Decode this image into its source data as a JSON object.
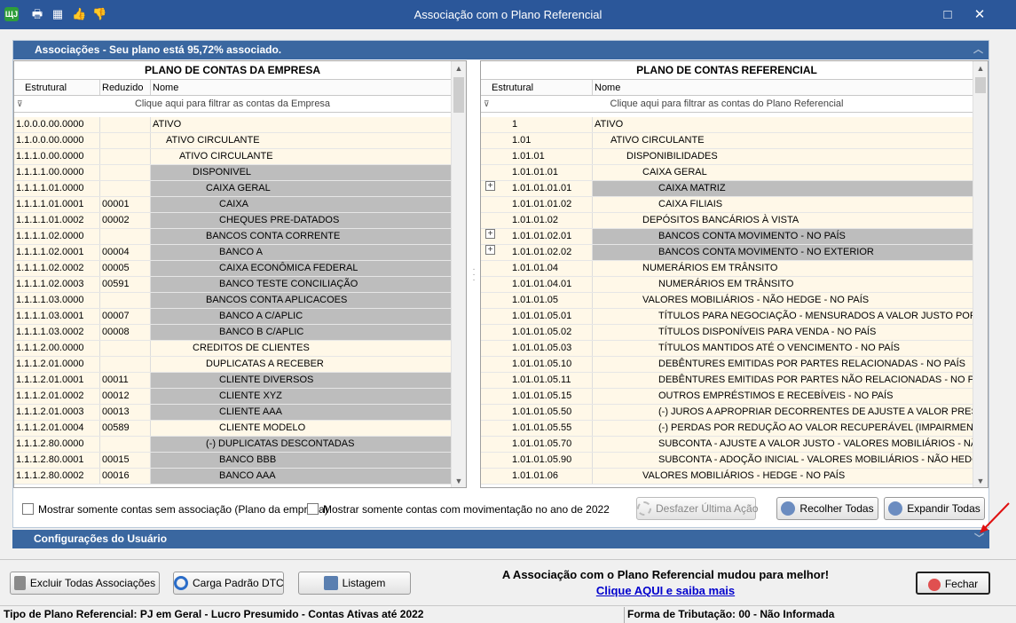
{
  "window": {
    "title": "Associação com o Plano Referencial",
    "maximize_glyph": "□",
    "close_glyph": "✕"
  },
  "assoc_header": "Associações - Seu plano está 95,72% associado.",
  "left_grid": {
    "title": "PLANO DE CONTAS DA EMPRESA",
    "col_estrutural": "Estrutural",
    "col_reduzido": "Reduzido",
    "col_nome": "Nome",
    "filter": "Clique aqui para filtrar as contas da Empresa",
    "rows": [
      {
        "e": "1.0.0.0.00.0000",
        "r": "",
        "n": "ATIVO",
        "lvl": 0,
        "sel": false
      },
      {
        "e": "1.1.0.0.00.0000",
        "r": "",
        "n": "ATIVO CIRCULANTE",
        "lvl": 1,
        "sel": false
      },
      {
        "e": "1.1.1.0.00.0000",
        "r": "",
        "n": "ATIVO CIRCULANTE",
        "lvl": 2,
        "sel": false
      },
      {
        "e": "1.1.1.1.00.0000",
        "r": "",
        "n": "DISPONIVEL",
        "lvl": 3,
        "sel": true
      },
      {
        "e": "1.1.1.1.01.0000",
        "r": "",
        "n": "CAIXA GERAL",
        "lvl": 4,
        "sel": true
      },
      {
        "e": "1.1.1.1.01.0001",
        "r": "00001",
        "n": "CAIXA",
        "lvl": 5,
        "sel": true
      },
      {
        "e": "1.1.1.1.01.0002",
        "r": "00002",
        "n": "CHEQUES PRE-DATADOS",
        "lvl": 5,
        "sel": true
      },
      {
        "e": "1.1.1.1.02.0000",
        "r": "",
        "n": "BANCOS CONTA CORRENTE",
        "lvl": 4,
        "sel": true
      },
      {
        "e": "1.1.1.1.02.0001",
        "r": "00004",
        "n": "BANCO A",
        "lvl": 5,
        "sel": true
      },
      {
        "e": "1.1.1.1.02.0002",
        "r": "00005",
        "n": "CAIXA ECONÔMICA FEDERAL",
        "lvl": 5,
        "sel": true
      },
      {
        "e": "1.1.1.1.02.0003",
        "r": "00591",
        "n": "BANCO TESTE CONCILIAÇÃO",
        "lvl": 5,
        "sel": true
      },
      {
        "e": "1.1.1.1.03.0000",
        "r": "",
        "n": "BANCOS CONTA APLICACOES",
        "lvl": 4,
        "sel": true
      },
      {
        "e": "1.1.1.1.03.0001",
        "r": "00007",
        "n": "BANCO A C/APLIC",
        "lvl": 5,
        "sel": true
      },
      {
        "e": "1.1.1.1.03.0002",
        "r": "00008",
        "n": "BANCO B C/APLIC",
        "lvl": 5,
        "sel": true
      },
      {
        "e": "1.1.1.2.00.0000",
        "r": "",
        "n": "CREDITOS DE CLIENTES",
        "lvl": 3,
        "sel": false
      },
      {
        "e": "1.1.1.2.01.0000",
        "r": "",
        "n": "DUPLICATAS A RECEBER",
        "lvl": 4,
        "sel": false
      },
      {
        "e": "1.1.1.2.01.0001",
        "r": "00011",
        "n": "CLIENTE DIVERSOS",
        "lvl": 5,
        "sel": true
      },
      {
        "e": "1.1.1.2.01.0002",
        "r": "00012",
        "n": "CLIENTE XYZ",
        "lvl": 5,
        "sel": true
      },
      {
        "e": "1.1.1.2.01.0003",
        "r": "00013",
        "n": "CLIENTE AAA",
        "lvl": 5,
        "sel": true
      },
      {
        "e": "1.1.1.2.01.0004",
        "r": "00589",
        "n": "CLIENTE MODELO",
        "lvl": 5,
        "sel": false
      },
      {
        "e": "1.1.1.2.80.0000",
        "r": "",
        "n": "(-) DUPLICATAS DESCONTADAS",
        "lvl": 4,
        "sel": true
      },
      {
        "e": "1.1.1.2.80.0001",
        "r": "00015",
        "n": "BANCO BBB",
        "lvl": 5,
        "sel": true
      },
      {
        "e": "1.1.1.2.80.0002",
        "r": "00016",
        "n": "BANCO AAA",
        "lvl": 5,
        "sel": true
      }
    ]
  },
  "right_grid": {
    "title": "PLANO DE CONTAS REFERENCIAL",
    "col_estrutural": "Estrutural",
    "col_nome": "Nome",
    "filter": "Clique aqui para filtrar as contas do Plano Referencial",
    "rows": [
      {
        "e": "1",
        "n": "ATIVO",
        "lvl": 0,
        "sel": false,
        "plus": false
      },
      {
        "e": "1.01",
        "n": "ATIVO CIRCULANTE",
        "lvl": 1,
        "sel": false,
        "plus": false
      },
      {
        "e": "1.01.01",
        "n": "DISPONIBILIDADES",
        "lvl": 2,
        "sel": false,
        "plus": false
      },
      {
        "e": "1.01.01.01",
        "n": "CAIXA GERAL",
        "lvl": 3,
        "sel": false,
        "plus": false
      },
      {
        "e": "1.01.01.01.01",
        "n": "CAIXA MATRIZ",
        "lvl": 4,
        "sel": true,
        "plus": true
      },
      {
        "e": "1.01.01.01.02",
        "n": "CAIXA FILIAIS",
        "lvl": 4,
        "sel": false,
        "plus": false
      },
      {
        "e": "1.01.01.02",
        "n": "DEPÓSITOS BANCÁRIOS À VISTA",
        "lvl": 3,
        "sel": false,
        "plus": false
      },
      {
        "e": "1.01.01.02.01",
        "n": "BANCOS CONTA MOVIMENTO - NO PAÍS",
        "lvl": 4,
        "sel": true,
        "plus": true
      },
      {
        "e": "1.01.01.02.02",
        "n": "BANCOS CONTA MOVIMENTO - NO EXTERIOR",
        "lvl": 4,
        "sel": true,
        "plus": true
      },
      {
        "e": "1.01.01.04",
        "n": "NUMERÁRIOS EM TRÂNSITO",
        "lvl": 3,
        "sel": false,
        "plus": false
      },
      {
        "e": "1.01.01.04.01",
        "n": "NUMERÁRIOS EM TRÂNSITO",
        "lvl": 4,
        "sel": false,
        "plus": false
      },
      {
        "e": "1.01.01.05",
        "n": "VALORES MOBILIÁRIOS - NÃO HEDGE - NO PAÍS",
        "lvl": 3,
        "sel": false,
        "plus": false
      },
      {
        "e": "1.01.01.05.01",
        "n": "TÍTULOS PARA NEGOCIAÇÃO - MENSURADOS A VALOR JUSTO POR MEIO",
        "lvl": 4,
        "sel": false,
        "plus": false
      },
      {
        "e": "1.01.01.05.02",
        "n": "TÍTULOS DISPONÍVEIS PARA VENDA - NO PAÍS",
        "lvl": 4,
        "sel": false,
        "plus": false
      },
      {
        "e": "1.01.01.05.03",
        "n": "TÍTULOS MANTIDOS ATÉ O VENCIMENTO - NO PAÍS",
        "lvl": 4,
        "sel": false,
        "plus": false
      },
      {
        "e": "1.01.01.05.10",
        "n": "DEBÊNTURES EMITIDAS POR PARTES RELACIONADAS - NO PAÍS",
        "lvl": 4,
        "sel": false,
        "plus": false
      },
      {
        "e": "1.01.01.05.11",
        "n": "DEBÊNTURES EMITIDAS POR PARTES NÃO RELACIONADAS - NO PAÍS",
        "lvl": 4,
        "sel": false,
        "plus": false
      },
      {
        "e": "1.01.01.05.15",
        "n": "OUTROS EMPRÉSTIMOS E RECEBÍVEIS - NO PAÍS",
        "lvl": 4,
        "sel": false,
        "plus": false
      },
      {
        "e": "1.01.01.05.50",
        "n": "(-) JUROS A APROPRIAR DECORRENTES DE AJUSTE A VALOR PRESENTE",
        "lvl": 4,
        "sel": false,
        "plus": false
      },
      {
        "e": "1.01.01.05.55",
        "n": "(-) PERDAS  POR REDUÇÃO AO VALOR RECUPERÁVEL (IMPAIRMENT)- VA",
        "lvl": 4,
        "sel": false,
        "plus": false
      },
      {
        "e": "1.01.01.05.70",
        "n": "SUBCONTA - AJUSTE A VALOR JUSTO - VALORES MOBILIÁRIOS - NÃO HE",
        "lvl": 4,
        "sel": false,
        "plus": false
      },
      {
        "e": "1.01.01.05.90",
        "n": "SUBCONTA - ADOÇÃO INICIAL -  VALORES MOBILIÁRIOS - NÃO HEDGE -",
        "lvl": 4,
        "sel": false,
        "plus": false
      },
      {
        "e": "1.01.01.06",
        "n": "VALORES MOBILIÁRIOS  - HEDGE - NO PAÍS",
        "lvl": 3,
        "sel": false,
        "plus": false
      }
    ]
  },
  "options": {
    "chk1": "Mostrar somente contas sem associação (Plano da empresa)",
    "chk2": "Mostrar somente contas com movimentação no ano de 2022",
    "undo": "Desfazer Última Ação",
    "collapse": "Recolher Todas",
    "expand": "Expandir Todas"
  },
  "config_header": "Configurações do Usuário",
  "bottom": {
    "delete_all": "Excluir Todas Associações",
    "load_default": "Carga Padrão DTC",
    "listing": "Listagem",
    "notice": "A Associação com o Plano Referencial mudou para melhor!",
    "link": "Clique AQUI e saiba mais",
    "close": "Fechar"
  },
  "status": {
    "left": "Tipo de Plano Referencial: PJ em Geral - Lucro Presumido - Contas Ativas até 2022",
    "right": "Forma de Tributação: 00 - Não Informada"
  },
  "colors": {
    "titlebar": "#2b579a",
    "section_header": "#3a67a0",
    "row_bg": "#fff8e8",
    "row_selected": "#bdbdbd",
    "link": "#0000cc"
  }
}
